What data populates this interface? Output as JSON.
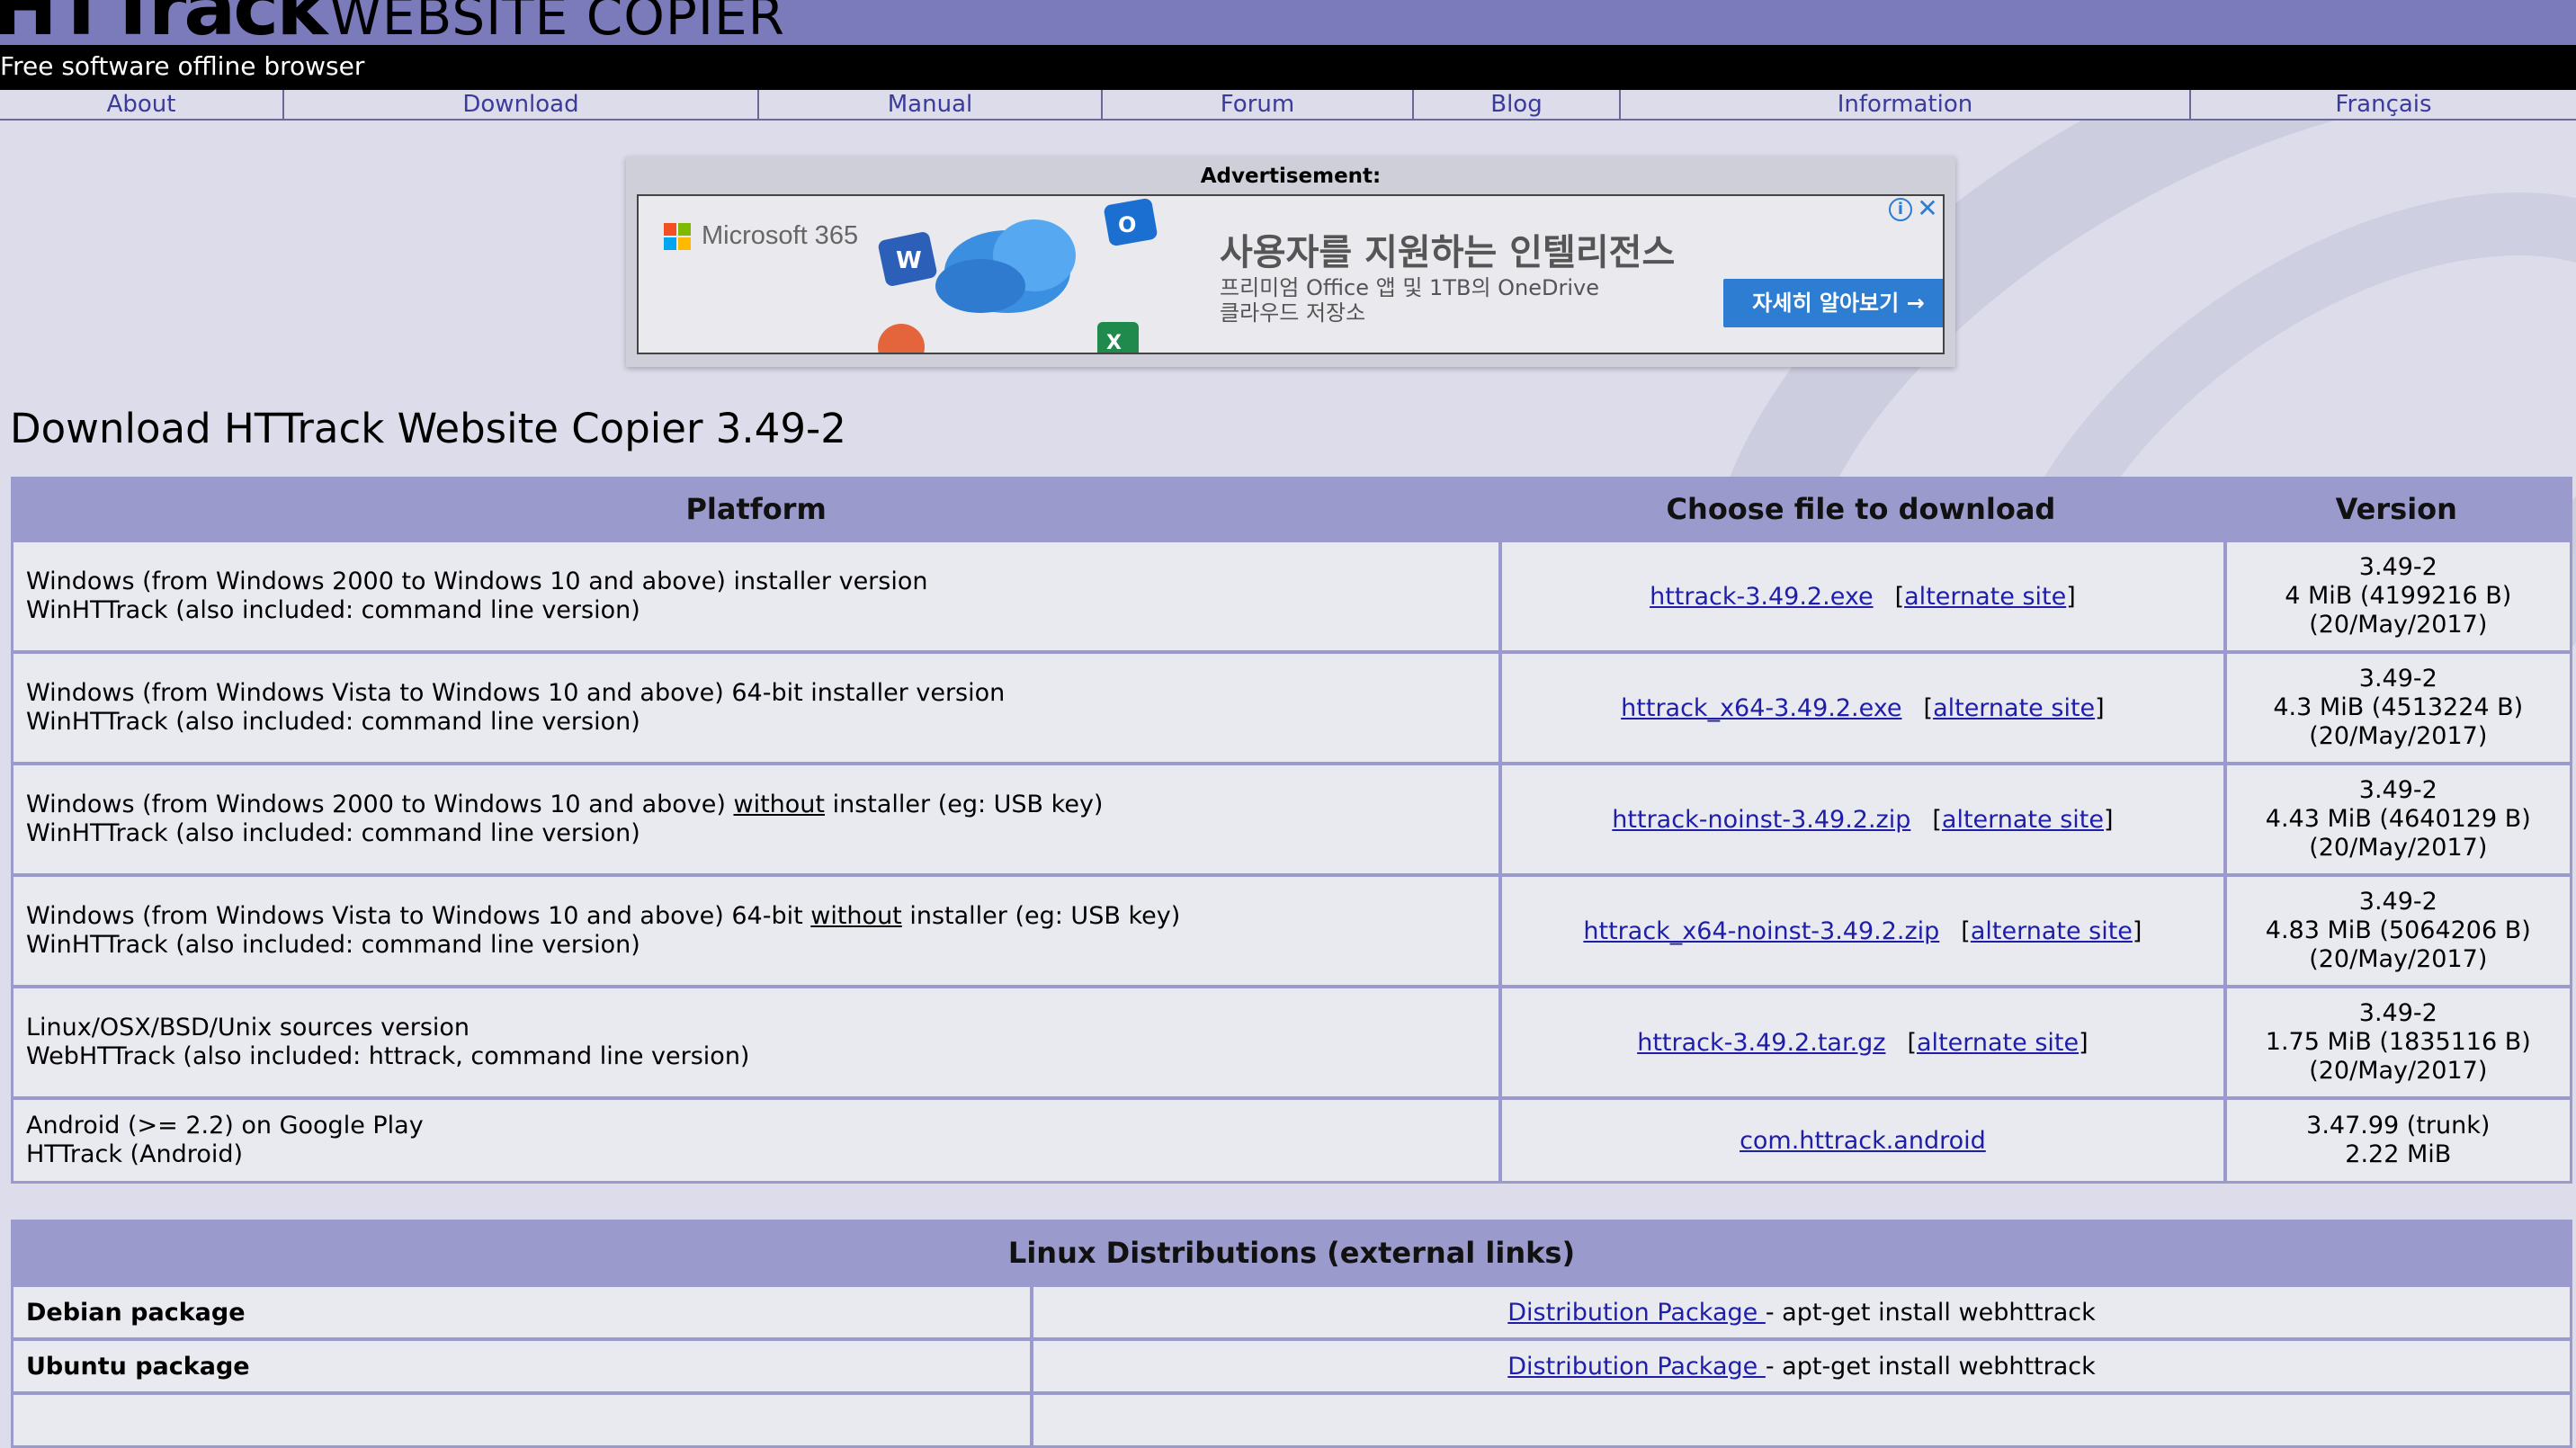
{
  "header": {
    "logo_big": "HTTrack",
    "logo_small": "WEBSITE COPIER",
    "tagline": "Free software offline browser"
  },
  "nav": [
    "About",
    "Download",
    "Manual",
    "Forum",
    "Blog",
    "Information",
    "Français"
  ],
  "ad": {
    "label": "Advertisement:",
    "brand": "Microsoft 365",
    "headline": "사용자를 지원하는 인텔리전스",
    "subtext_line1": "프리미엄 Office 앱 및 1TB의 OneDrive",
    "subtext_line2": "클라우드 저장소",
    "cta": "자세히 알아보기 →"
  },
  "page": {
    "title": "Download HTTrack Website Copier 3.49-2"
  },
  "download_table": {
    "headers": [
      "Platform",
      "Choose file to download",
      "Version"
    ],
    "alternate_label": "alternate site",
    "rows": [
      {
        "platform_line1_pre": "Windows (from Windows 2000 to Windows 10 and above) installer version",
        "platform_line1_emph": "",
        "platform_line1_post": "",
        "platform_line2": "WinHTTrack (also included: command line version)",
        "file": "httrack-3.49.2.exe",
        "has_alt": true,
        "version": "3.49-2",
        "size": "4 MiB (4199216 B)",
        "date": "(20/May/2017)"
      },
      {
        "platform_line1_pre": "Windows (from Windows Vista to Windows 10 and above) 64-bit installer version",
        "platform_line1_emph": "",
        "platform_line1_post": "",
        "platform_line2": "WinHTTrack (also included: command line version)",
        "file": "httrack_x64-3.49.2.exe",
        "has_alt": true,
        "version": "3.49-2",
        "size": "4.3 MiB (4513224 B)",
        "date": "(20/May/2017)"
      },
      {
        "platform_line1_pre": "Windows (from Windows 2000 to Windows 10 and above) ",
        "platform_line1_emph": "without",
        "platform_line1_post": " installer (eg: USB key)",
        "platform_line2": "WinHTTrack (also included: command line version)",
        "file": "httrack-noinst-3.49.2.zip",
        "has_alt": true,
        "version": "3.49-2",
        "size": "4.43 MiB (4640129 B)",
        "date": "(20/May/2017)"
      },
      {
        "platform_line1_pre": "Windows (from Windows Vista to Windows 10 and above) 64-bit ",
        "platform_line1_emph": "without",
        "platform_line1_post": " installer (eg: USB key)",
        "platform_line2": "WinHTTrack (also included: command line version)",
        "file": "httrack_x64-noinst-3.49.2.zip",
        "has_alt": true,
        "version": "3.49-2",
        "size": "4.83 MiB (5064206 B)",
        "date": "(20/May/2017)"
      },
      {
        "platform_line1_pre": "Linux/OSX/BSD/Unix sources version",
        "platform_line1_emph": "",
        "platform_line1_post": "",
        "platform_line2": "WebHTTrack (also included: httrack, command line version)",
        "file": "httrack-3.49.2.tar.gz",
        "has_alt": true,
        "version": "3.49-2",
        "size": "1.75 MiB (1835116 B)",
        "date": "(20/May/2017)"
      },
      {
        "platform_line1_pre": "Android (>= 2.2) on Google Play",
        "platform_line1_emph": "",
        "platform_line1_post": "",
        "platform_line2": "HTTrack (Android)",
        "file": "com.httrack.android",
        "has_alt": false,
        "version": "3.47.99 (trunk)",
        "size": "2.22 MiB",
        "date": ""
      }
    ]
  },
  "linux_table": {
    "header": "Linux Distributions (external links)",
    "link_label": "Distribution Package ",
    "rows": [
      {
        "name": "Debian package",
        "command": "- apt-get install webhttrack"
      },
      {
        "name": "Ubuntu package",
        "command": "- apt-get install webhttrack"
      }
    ]
  }
}
